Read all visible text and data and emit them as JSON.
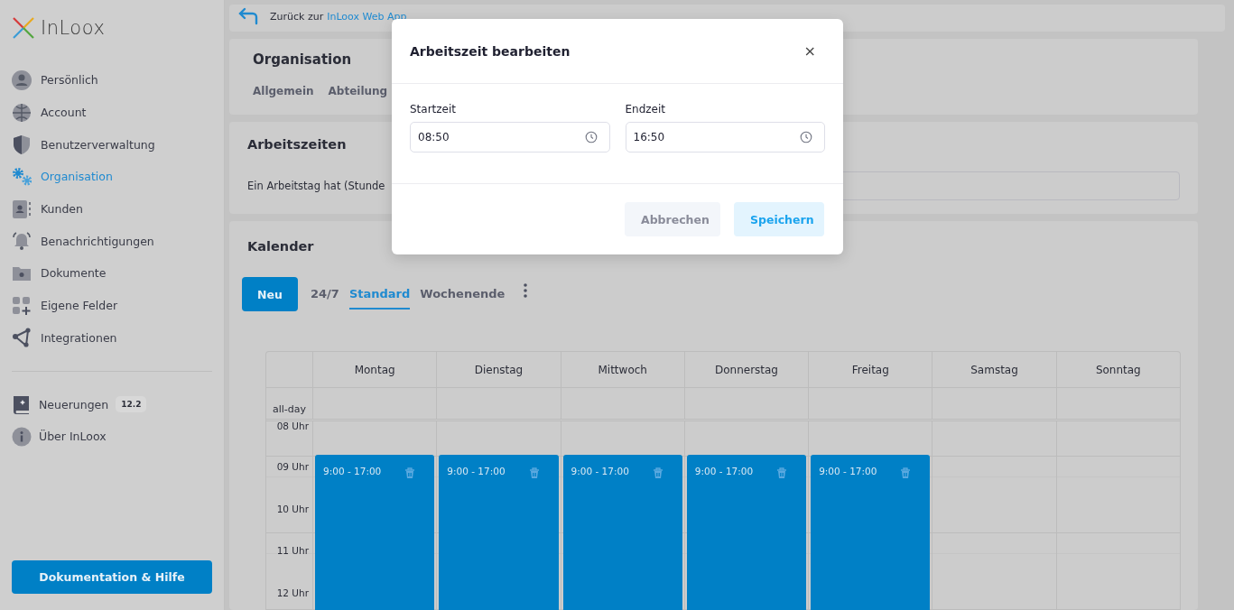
{
  "sidebar": {
    "logo": "InLoox",
    "items": [
      {
        "label": "Persönlich",
        "selected": false
      },
      {
        "label": "Account",
        "selected": false
      },
      {
        "label": "Benutzerverwaltung",
        "selected": false
      },
      {
        "label": "Organisation",
        "selected": true
      },
      {
        "label": "Kunden",
        "selected": false
      },
      {
        "label": "Benachrichtigungen",
        "selected": false
      },
      {
        "label": "Dokumente",
        "selected": false
      },
      {
        "label": "Eigene Felder",
        "selected": false
      },
      {
        "label": "Integrationen",
        "selected": false
      }
    ],
    "footer_items": [
      {
        "label": "Neuerungen",
        "badge": "12.2"
      },
      {
        "label": "Über InLoox"
      }
    ],
    "help_button": "Dokumentation & Hilfe"
  },
  "back_bar": {
    "text": "Zurück zur",
    "link": "InLoox Web App"
  },
  "organisation": {
    "title": "Organisation",
    "tabs": [
      "Allgemein",
      "Abteilung"
    ]
  },
  "arbeitszeiten": {
    "title": "Arbeitszeiten",
    "label": "Ein Arbeitstag hat (Stunde"
  },
  "kalender": {
    "title": "Kalender",
    "new_button": "Neu",
    "tabs": [
      {
        "label": "24/7",
        "selected": false
      },
      {
        "label": "Standard",
        "selected": true
      },
      {
        "label": "Wochenende",
        "selected": false
      }
    ],
    "all_day_label": "all-day",
    "hours": [
      "08 Uhr",
      "09 Uhr",
      "10 Uhr",
      "11 Uhr",
      "12 Uhr"
    ],
    "days": [
      {
        "name": "Montag",
        "events": [
          {
            "time": "9:00 - 17:00"
          }
        ]
      },
      {
        "name": "Dienstag",
        "events": [
          {
            "time": "9:00 - 17:00"
          }
        ]
      },
      {
        "name": "Mittwoch",
        "events": [
          {
            "time": "9:00 - 17:00"
          }
        ]
      },
      {
        "name": "Donnerstag",
        "events": [
          {
            "time": "9:00 - 17:00"
          }
        ]
      },
      {
        "name": "Freitag",
        "events": [
          {
            "time": "9:00 - 17:00"
          }
        ]
      },
      {
        "name": "Samstag"
      },
      {
        "name": "Sonntag"
      }
    ]
  },
  "dialog": {
    "title": "Arbeitszeit bearbeiten",
    "close": "×",
    "fields": [
      {
        "label": "Startzeit",
        "value": "08:50"
      },
      {
        "label": "Endzeit",
        "value": "16:50"
      }
    ],
    "buttons": [
      {
        "label": "Abbrechen",
        "kind": "secondary"
      },
      {
        "label": "Speichern",
        "kind": "primary"
      }
    ]
  }
}
